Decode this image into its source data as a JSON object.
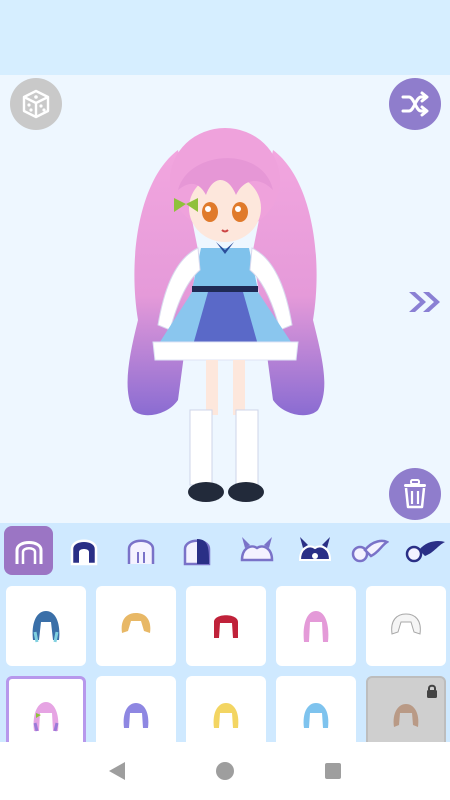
{
  "app": {
    "screen": "dress-up editor"
  },
  "colors": {
    "accent": "#8f7dcc",
    "active_tab": "#9b75c4",
    "panel_bg": "#cfe9ff",
    "top_bg": "#d6eeff"
  },
  "toolbar": {
    "dice_icon": "dice-icon",
    "shuffle_icon": "shuffle-icon",
    "trash_icon": "trash-icon",
    "next_icon": "double-chevron-right-icon"
  },
  "tabs": [
    {
      "icon": "front-hair-icon",
      "active": true
    },
    {
      "icon": "hair-back-icon",
      "active": false
    },
    {
      "icon": "bangs-icon",
      "active": false
    },
    {
      "icon": "hair-side-icon",
      "active": false
    },
    {
      "icon": "horns-icon",
      "active": false
    },
    {
      "icon": "horns-dark-icon",
      "active": false
    },
    {
      "icon": "wing-icon",
      "active": false
    },
    {
      "icon": "wing-dark-icon",
      "active": false
    }
  ],
  "items": [
    {
      "name": "hair-blue-teal",
      "color": "#3a6fa8",
      "selected": false,
      "locked": false
    },
    {
      "name": "hair-blonde-short",
      "color": "#e8b866",
      "selected": false,
      "locked": false
    },
    {
      "name": "hair-red",
      "color": "#c0223a",
      "selected": false,
      "locked": false
    },
    {
      "name": "hair-pink-long",
      "color": "#e49ad8",
      "selected": false,
      "locked": false
    },
    {
      "name": "hair-white",
      "color": "#f2f2f2",
      "selected": false,
      "locked": false
    },
    {
      "name": "hair-pink-purple",
      "color": "#e6a4e3",
      "selected": true,
      "locked": false
    },
    {
      "name": "hair-lavender",
      "color": "#8e87e2",
      "selected": false,
      "locked": false
    },
    {
      "name": "hair-yellow",
      "color": "#f3d562",
      "selected": false,
      "locked": false
    },
    {
      "name": "hair-sky-blue",
      "color": "#7ec3ee",
      "selected": false,
      "locked": false
    },
    {
      "name": "hair-brown-locked",
      "color": "#b99a86",
      "selected": false,
      "locked": true
    }
  ],
  "navbar": {
    "back_icon": "back-triangle-icon",
    "home_icon": "home-circle-icon",
    "recents_icon": "recents-square-icon"
  }
}
